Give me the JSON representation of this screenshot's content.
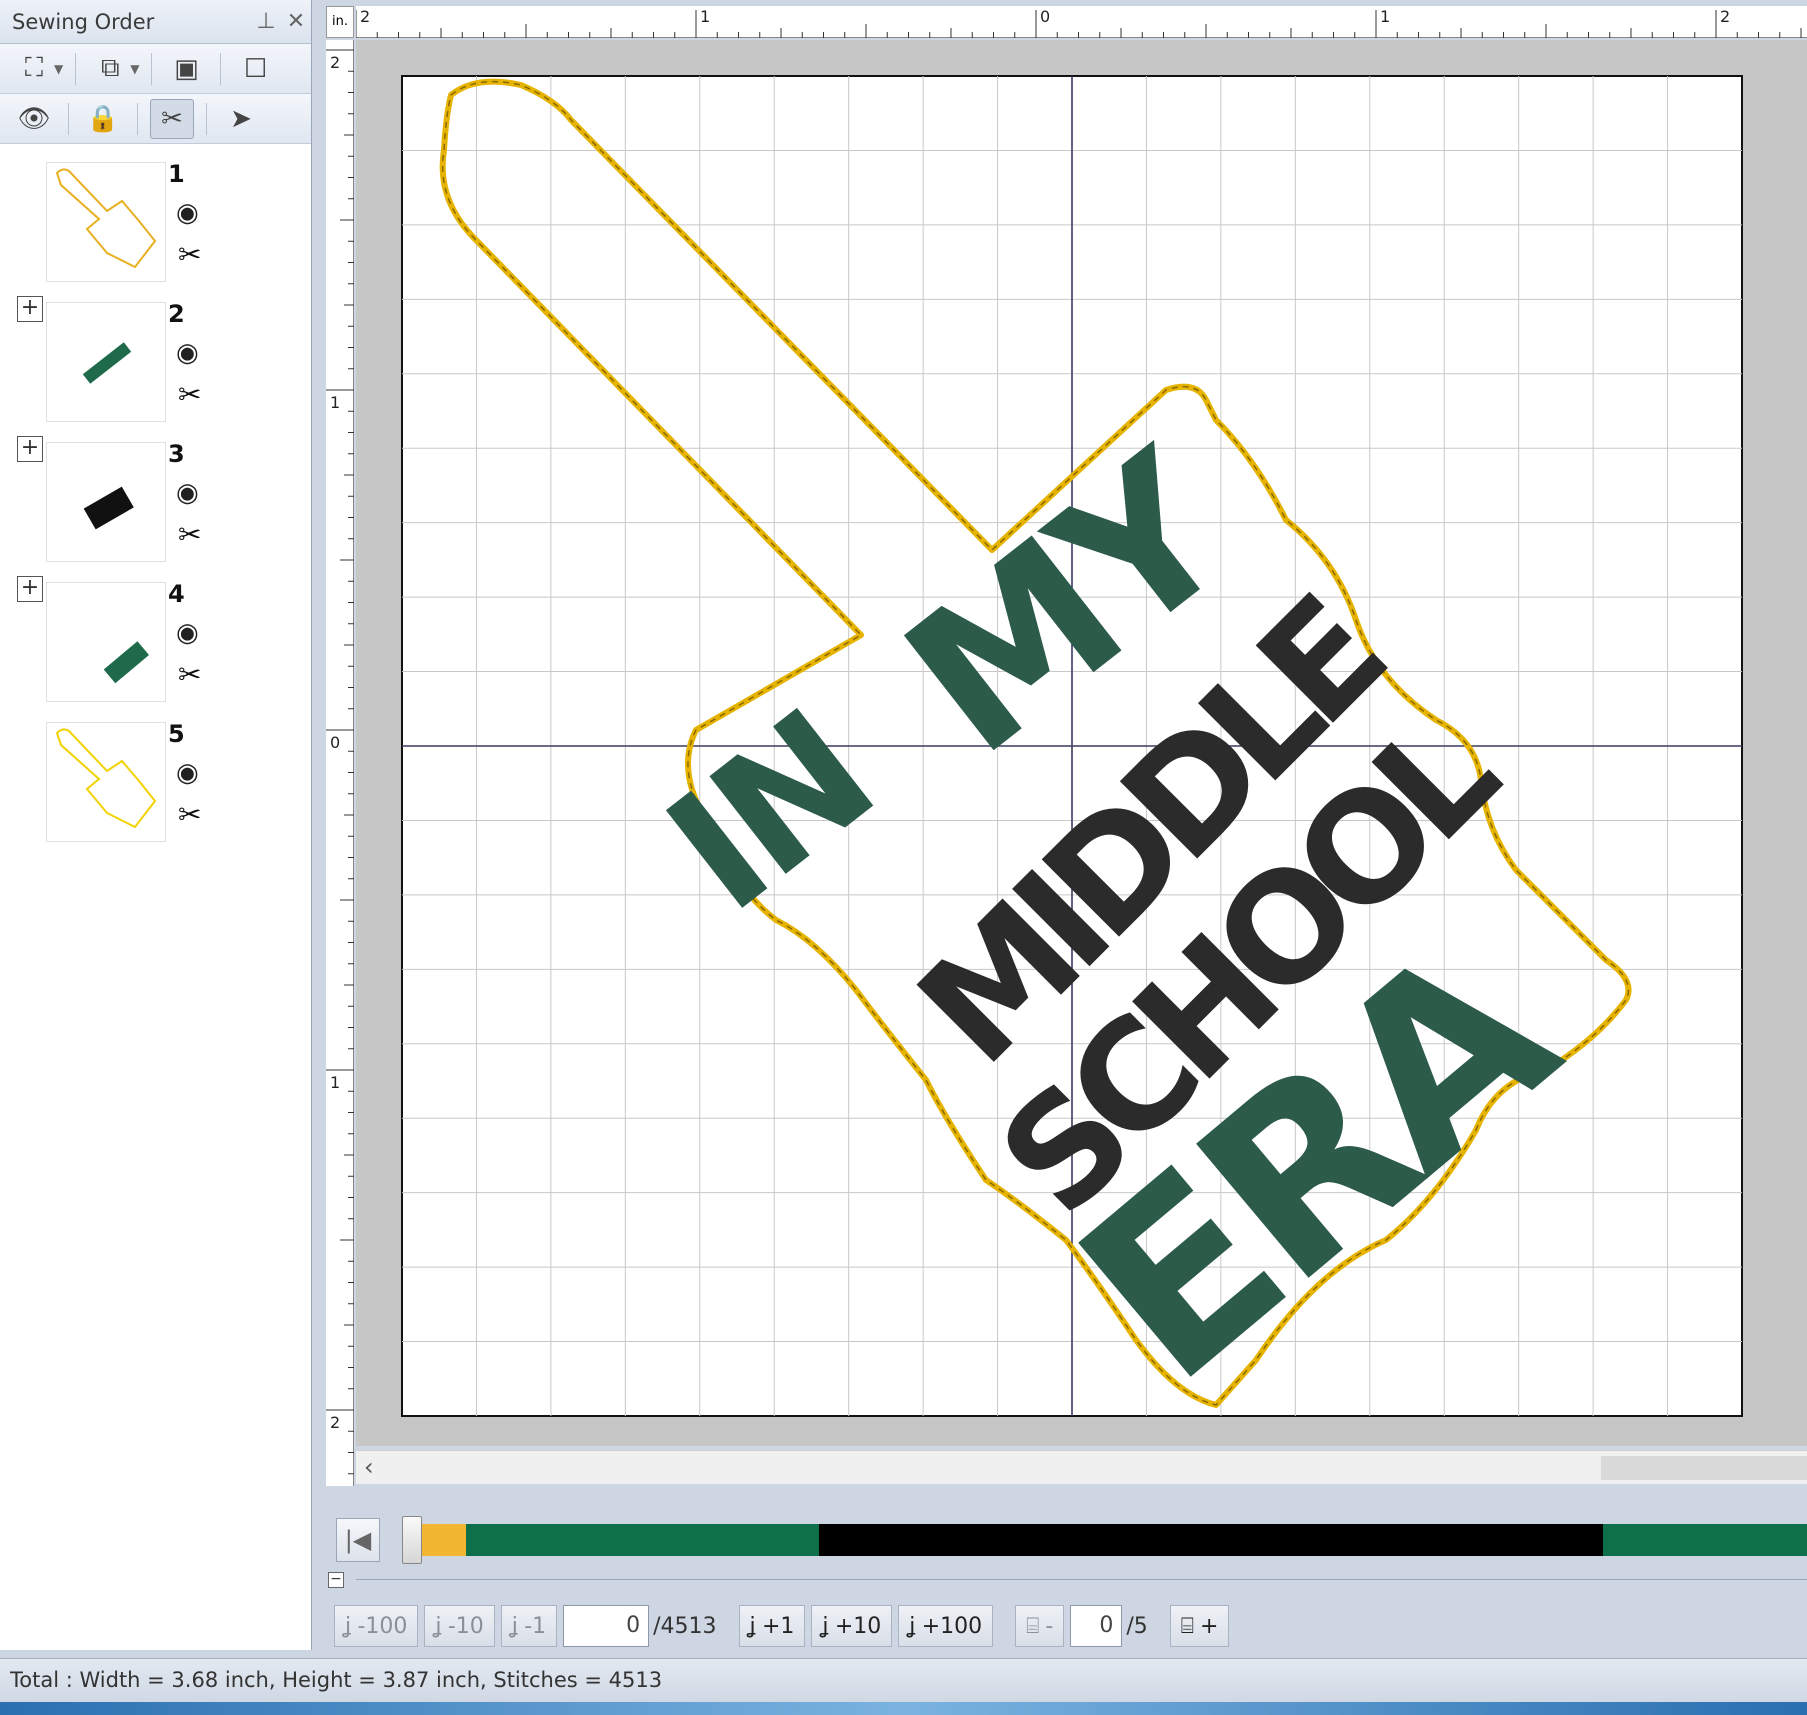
{
  "panel": {
    "title": "Sewing Order",
    "pin_icon": "pin-icon",
    "close_icon": "close-icon"
  },
  "toolbar1": [
    {
      "name": "zoom-to-fit-icon",
      "glyph": "⛶",
      "dropdown": true
    },
    {
      "name": "group-select-icon",
      "glyph": "⧉",
      "dropdown": true
    },
    {
      "name": "color-layers-icon",
      "glyph": "▣",
      "dropdown": false
    },
    {
      "name": "hoop-frame-icon",
      "glyph": "☐",
      "dropdown": false
    }
  ],
  "toolbar2": [
    {
      "name": "visibility-eye-icon",
      "glyph": "👁",
      "pressed": false
    },
    {
      "name": "lock-icon",
      "glyph": "🔒",
      "pressed": false
    },
    {
      "name": "trim-scissors-icon",
      "glyph": "✂",
      "pressed": true
    },
    {
      "name": "select-pointer-icon",
      "glyph": "➤",
      "pressed": false
    }
  ],
  "order_items": [
    {
      "num": "1",
      "expandable": false,
      "thumb_color": "#e8b020",
      "kind": "outline"
    },
    {
      "num": "2",
      "expandable": true,
      "thumb_color": "#1f6a4a",
      "kind": "text-small"
    },
    {
      "num": "3",
      "expandable": true,
      "thumb_color": "#111111",
      "kind": "text-block"
    },
    {
      "num": "4",
      "expandable": true,
      "thumb_color": "#1f6a4a",
      "kind": "text-era"
    },
    {
      "num": "5",
      "expandable": false,
      "thumb_color": "#f2d200",
      "kind": "outline"
    }
  ],
  "ruler": {
    "unit": "in.",
    "top_labels": [
      "2",
      "1",
      "0",
      "1",
      "2"
    ],
    "left_labels": [
      "2",
      "1",
      "0",
      "1",
      "2"
    ]
  },
  "design": {
    "words": [
      "IN",
      "MY",
      "MIDDLE",
      "SCHOOL",
      "ERA"
    ],
    "outline_color": "#e6b400",
    "green": "#2c5b4a",
    "dark": "#2b2b2b"
  },
  "color_sequence": [
    {
      "color": "#f2b632",
      "fraction": 0.032
    },
    {
      "color": "#0e7048",
      "fraction": 0.255
    },
    {
      "color": "#000000",
      "fraction": 0.566
    },
    {
      "color": "#0e7048",
      "fraction": 0.015
    }
  ],
  "stitch_controls": {
    "back100": "-100",
    "back10": "-10",
    "back1": "-1",
    "current": "0",
    "total": "/4513",
    "fwd1": "+1",
    "fwd10": "+10",
    "fwd100": "+100",
    "color_back": "-",
    "color_current": "0",
    "color_total": "/5",
    "color_fwd": "+"
  },
  "status": {
    "text": "Total : Width = 3.68 inch, Height = 3.87 inch, Stitches = 4513"
  }
}
